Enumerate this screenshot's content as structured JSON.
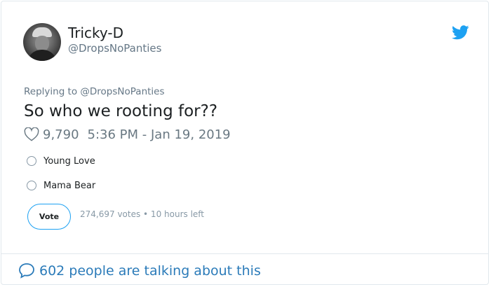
{
  "author": {
    "display_name": "Tricky-D",
    "handle": "@DropsNoPanties"
  },
  "tweet": {
    "replying_to": "Replying to @DropsNoPanties",
    "text": "So who we rooting for??",
    "likes": "9,790",
    "timestamp": "5:36 PM - Jan 19, 2019"
  },
  "poll": {
    "options": [
      {
        "label": "Young Love"
      },
      {
        "label": "Mama Bear"
      }
    ],
    "vote_label": "Vote",
    "meta": "274,697 votes • 10 hours left"
  },
  "footer": {
    "talking_text": "602 people are talking about this"
  },
  "icons": {
    "brand": "twitter-bird-icon",
    "like": "heart-outline-icon",
    "talk": "speech-bubble-icon"
  },
  "colors": {
    "brand_blue": "#1da1f2",
    "link_blue": "#2b7bb9",
    "muted_text": "#657786",
    "text": "#1c2022",
    "border": "#e1e8ed"
  }
}
